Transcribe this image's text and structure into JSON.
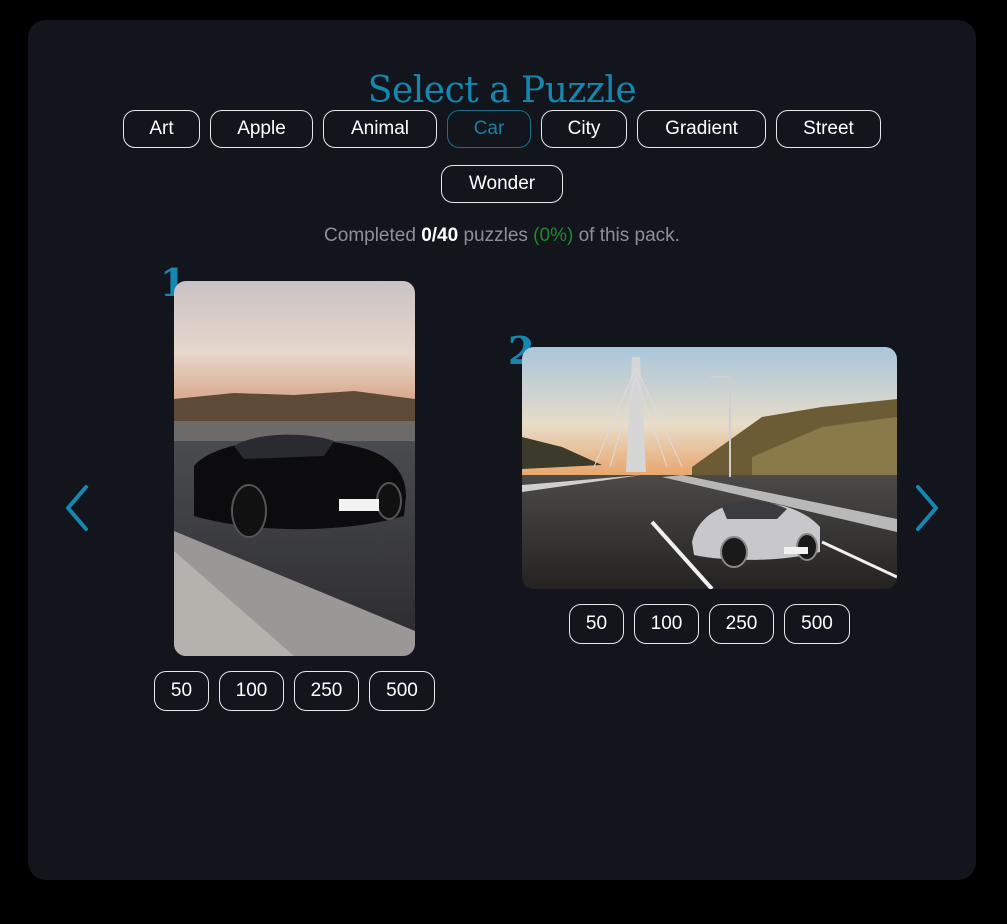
{
  "title": "Select a Puzzle",
  "categories": [
    {
      "label": "Art",
      "active": false
    },
    {
      "label": "Apple",
      "active": false
    },
    {
      "label": "Animal",
      "active": false
    },
    {
      "label": "Car",
      "active": true
    },
    {
      "label": "City",
      "active": false
    },
    {
      "label": "Gradient",
      "active": false
    },
    {
      "label": "Street",
      "active": false
    },
    {
      "label": "Wonder",
      "active": false
    }
  ],
  "status": {
    "prefix": "Completed ",
    "count": "0/40",
    "middle": " puzzles ",
    "percent": "(0%)",
    "suffix": " of this pack."
  },
  "colors": {
    "accent": "#1587b0",
    "background": "#12151c",
    "success": "#1e8a2a"
  },
  "nav": {
    "prev_icon": "chevron-left-icon",
    "next_icon": "chevron-right-icon"
  },
  "puzzles": [
    {
      "number": "1",
      "image": "black sports car on road at sunset",
      "sizes": [
        "50",
        "100",
        "250",
        "500"
      ]
    },
    {
      "number": "2",
      "image": "silver car on highway near cable-stayed bridge",
      "sizes": [
        "50",
        "100",
        "250",
        "500"
      ]
    }
  ]
}
